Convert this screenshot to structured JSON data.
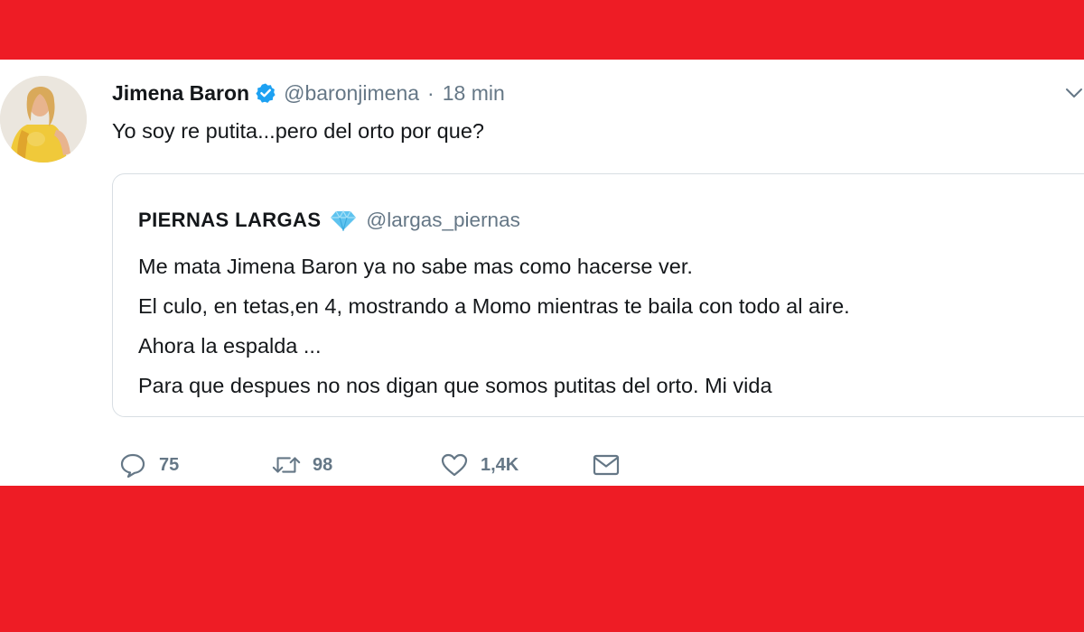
{
  "tweet": {
    "author_name": "Jimena Baron",
    "author_handle": "@baronjimena",
    "separator": "·",
    "time": "18 min",
    "text": "Yo soy re putita...pero del orto por que?",
    "verified": true,
    "quoted": {
      "author_name": "PIERNAS LARGAS",
      "author_handle": "@largas_piernas",
      "lines": [
        "Me mata Jimena Baron ya no sabe mas como hacerse ver.",
        "El culo, en tetas,en 4, mostrando a Momo mientras te baila con todo al aire.",
        "Ahora la espalda ...",
        "Para que despues no nos digan que somos putitas del orto. Mi vida"
      ]
    },
    "actions": {
      "replies": "75",
      "retweets": "98",
      "likes": "1,4K"
    }
  },
  "colors": {
    "background_bands": "#ee1c25",
    "card": "#ffffff",
    "name_text": "#14171a",
    "secondary_text": "#657786",
    "verified_blue": "#1da1f2",
    "diamond": "#5ec3ef"
  },
  "icons": {
    "verified": "verified-badge-icon",
    "caret": "chevron-down-icon",
    "diamond": "diamond-emoji-icon",
    "reply": "reply-icon",
    "retweet": "retweet-icon",
    "like": "heart-icon",
    "message": "envelope-icon"
  }
}
